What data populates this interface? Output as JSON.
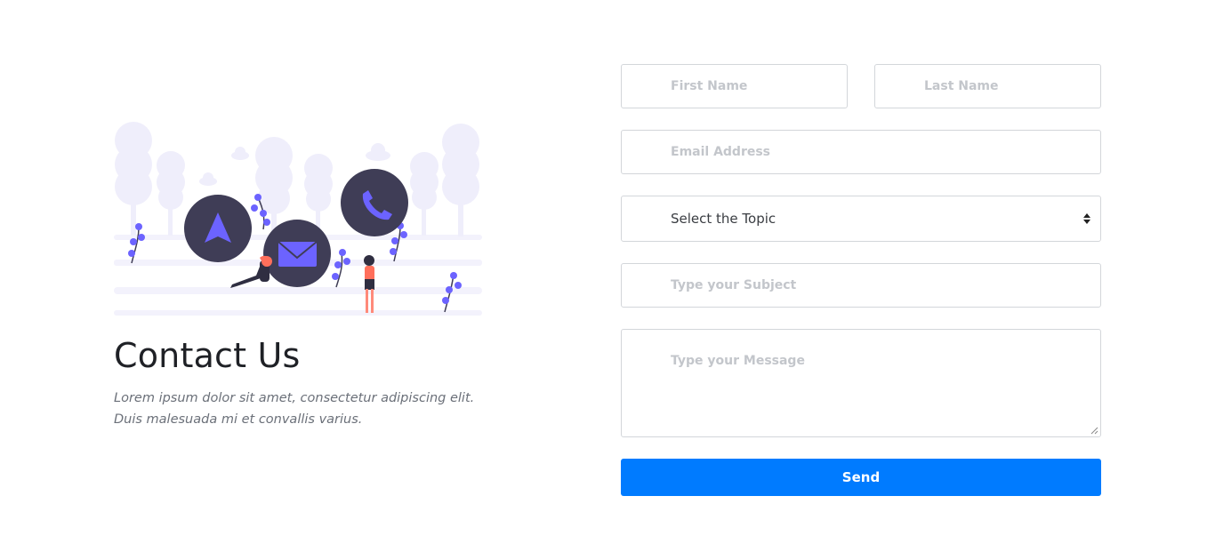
{
  "contact": {
    "title": "Contact Us",
    "description_line1": "Lorem ipsum dolor sit amet, consectetur adipiscing elit.",
    "description_line2": "Duis malesuada mi et convallis varius."
  },
  "form": {
    "first_name_placeholder": "First Name",
    "last_name_placeholder": "Last Name",
    "email_placeholder": "Email Address",
    "topic_selected": "Select the Topic",
    "subject_placeholder": "Type your Subject",
    "message_placeholder": "Type your Message",
    "send_label": "Send"
  },
  "colors": {
    "accent": "#007bff",
    "illustration_purple": "#6c63ff",
    "illustration_dark": "#3f3d56",
    "illustration_person": "#ff6f5b",
    "tree_lavender": "#efeefb"
  },
  "icons": [
    "navigation-arrow-icon",
    "envelope-icon",
    "phone-icon"
  ]
}
